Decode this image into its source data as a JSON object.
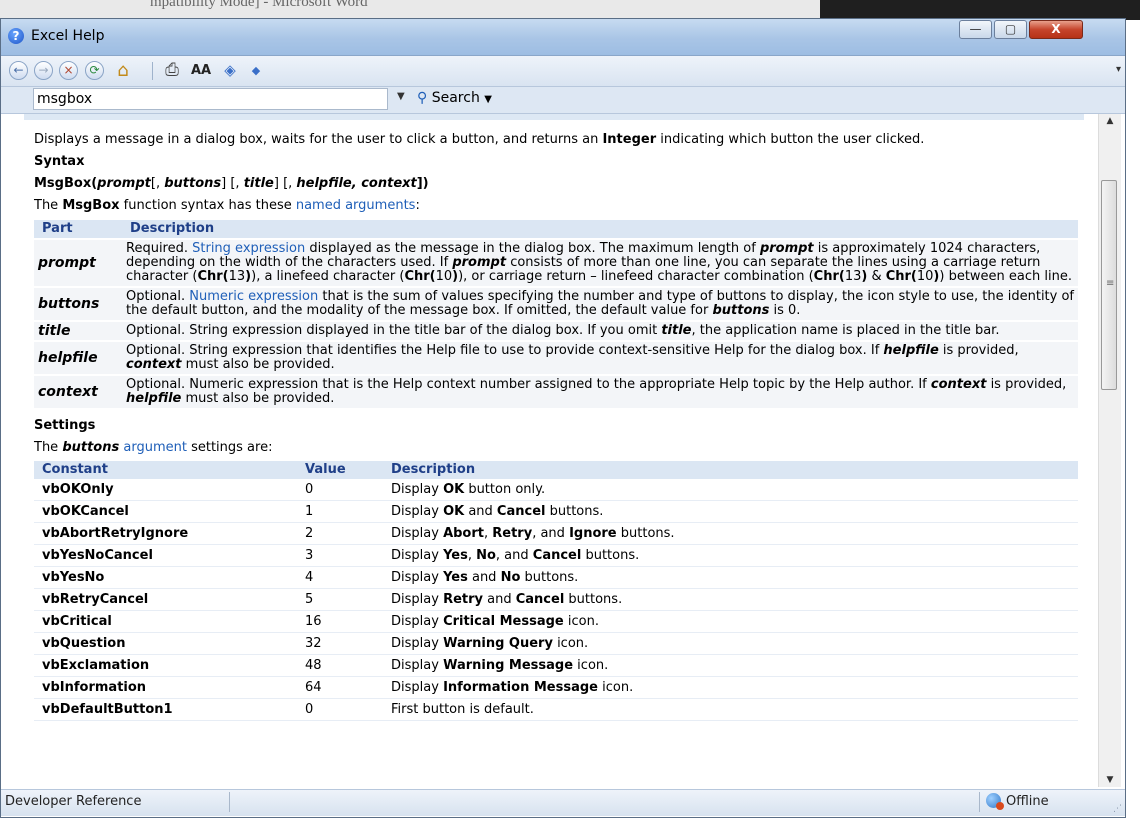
{
  "background_window": {
    "title_fragment": "mpatibility Mode] - Microsoft Word"
  },
  "window": {
    "title": "Excel Help",
    "min_glyph": "—",
    "max_glyph": "▢",
    "close_glyph": "X"
  },
  "toolbar": {
    "icons": [
      "back-icon",
      "forward-icon",
      "stop-icon",
      "refresh-icon",
      "home-icon",
      "print-icon",
      "font-size-icon",
      "table-of-contents-icon",
      "keep-on-top-icon"
    ],
    "back": "←",
    "forward": "→",
    "stop": "×",
    "refresh": "⟳",
    "home": "⌂",
    "print": "⎙",
    "fontsize": "AA",
    "toc": "◈",
    "pin": "◆"
  },
  "search": {
    "value": "msgbox",
    "button_label": "Search"
  },
  "content": {
    "intro_a": "Displays a message in a dialog box, waits for the user to click a button, and returns an ",
    "intro_b": "Integer",
    "intro_c": " indicating which button the user clicked.",
    "syntax_heading": "Syntax",
    "syntax_line": {
      "fn": "MsgBox(",
      "prompt": "prompt",
      "s1": "[, ",
      "buttons": "buttons",
      "s2": "] [, ",
      "title": "title",
      "s3": "] [, ",
      "helpfile": "helpfile, context",
      "s4": "])"
    },
    "named_a": "The ",
    "named_b": "MsgBox",
    "named_c": " function syntax has these ",
    "named_link": "named arguments",
    "named_d": ":",
    "args_header": {
      "part": "Part",
      "description": "Description"
    },
    "args": [
      {
        "part": "prompt",
        "d1": "Required. ",
        "link": "String expression",
        "d2": " displayed as the message in the dialog box. The maximum length of ",
        "b1": "prompt",
        "d3": " is approximately 1024 characters, depending on the width of the characters used. If ",
        "b2": "prompt",
        "d4": " consists of more than one line, you can separate the lines using a carriage return character (",
        "c1": "Chr(",
        "n1": "13",
        "c1e": ")",
        "d5": "), a linefeed character (",
        "c2": "Chr(",
        "n2": "10",
        "c2e": ")",
        "d6": "), or carriage return – linefeed character combination (",
        "c3": "Chr(",
        "n3": "13",
        "c3e": ")",
        "amp": " & ",
        "c4": "Chr(",
        "n4": "10",
        "c4e": ")",
        "d7": ") between each line."
      },
      {
        "part": "buttons",
        "d1": "Optional. ",
        "link": "Numeric expression",
        "d2": " that is the sum of values specifying the number and type of buttons to display, the icon style to use, the identity of the default button, and the modality of the message box. If omitted, the default value for ",
        "b1": "buttons",
        "d3": " is 0."
      },
      {
        "part": "title",
        "d1": "Optional. String expression displayed in the title bar of the dialog box. If you omit ",
        "b1": "title",
        "d2": ", the application name is placed in the title bar."
      },
      {
        "part": "helpfile",
        "d1": "Optional. String expression that identifies the Help file to use to provide context-sensitive Help for the dialog box. If ",
        "b1": "helpfile",
        "d2": " is provided, ",
        "b2": "context",
        "d3": " must also be provided."
      },
      {
        "part": "context",
        "d1": "Optional. Numeric expression that is the Help context number assigned to the appropriate Help topic by the Help author. If ",
        "b1": "context",
        "d2": " is provided, ",
        "b2": "helpfile",
        "d3": " must also be provided."
      }
    ],
    "settings_heading": "Settings",
    "settings_a": "The ",
    "settings_b": "buttons",
    "settings_link": " argument",
    "settings_c": " settings are:",
    "consts_header": {
      "constant": "Constant",
      "value": "Value",
      "description": "Description"
    },
    "constants": [
      {
        "name": "vbOKOnly",
        "value": "0",
        "pre": "Display ",
        "bold": "OK",
        "post": " button only."
      },
      {
        "name": "vbOKCancel",
        "value": "1",
        "pre": "Display ",
        "bold": "OK",
        "mid": " and ",
        "bold2": "Cancel",
        "post": " buttons."
      },
      {
        "name": "vbAbortRetryIgnore",
        "value": "2",
        "pre": "Display ",
        "bold": "Abort",
        "mid": ", ",
        "bold2": "Retry",
        "mid2": ", and ",
        "bold3": "Ignore",
        "post": " buttons."
      },
      {
        "name": "vbYesNoCancel",
        "value": "3",
        "pre": "Display ",
        "bold": "Yes",
        "mid": ", ",
        "bold2": "No",
        "mid2": ", and ",
        "bold3": "Cancel",
        "post": " buttons."
      },
      {
        "name": "vbYesNo",
        "value": "4",
        "pre": "Display ",
        "bold": "Yes",
        "mid": " and ",
        "bold2": "No",
        "post": " buttons."
      },
      {
        "name": "vbRetryCancel",
        "value": "5",
        "pre": "Display ",
        "bold": "Retry",
        "mid": " and ",
        "bold2": "Cancel",
        "post": " buttons."
      },
      {
        "name": "vbCritical",
        "value": "16",
        "pre": "Display ",
        "bold": "Critical Message",
        "post": " icon."
      },
      {
        "name": "vbQuestion",
        "value": "32",
        "pre": "Display ",
        "bold": "Warning Query",
        "post": " icon."
      },
      {
        "name": "vbExclamation",
        "value": "48",
        "pre": "Display ",
        "bold": "Warning Message",
        "post": " icon."
      },
      {
        "name": "vbInformation",
        "value": "64",
        "pre": "Display ",
        "bold": "Information Message",
        "post": " icon."
      },
      {
        "name": "vbDefaultButton1",
        "value": "0",
        "pre": "First button is default.",
        "post": ""
      }
    ]
  },
  "status": {
    "left": "Developer Reference",
    "right": "Offline"
  }
}
